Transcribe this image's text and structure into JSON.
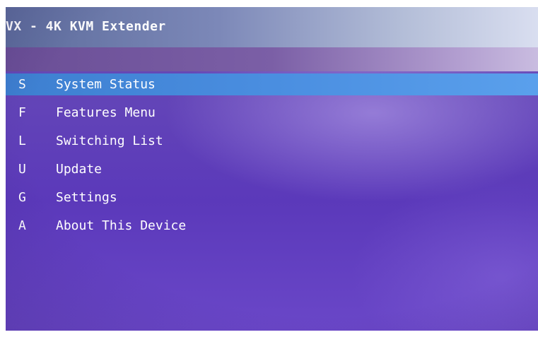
{
  "window": {
    "title": "VX - 4K KVM Extender"
  },
  "menu": {
    "items": [
      {
        "key": "S",
        "label": "System Status",
        "selected": true
      },
      {
        "key": "F",
        "label": "Features Menu",
        "selected": false
      },
      {
        "key": "L",
        "label": "Switching List",
        "selected": false
      },
      {
        "key": "U",
        "label": "Update",
        "selected": false
      },
      {
        "key": "G",
        "label": "Settings",
        "selected": false
      },
      {
        "key": "A",
        "label": "About This Device",
        "selected": false
      }
    ]
  },
  "colors": {
    "background": "#5b39ba",
    "selection": "#4a8ee0",
    "text": "#ffffff"
  }
}
